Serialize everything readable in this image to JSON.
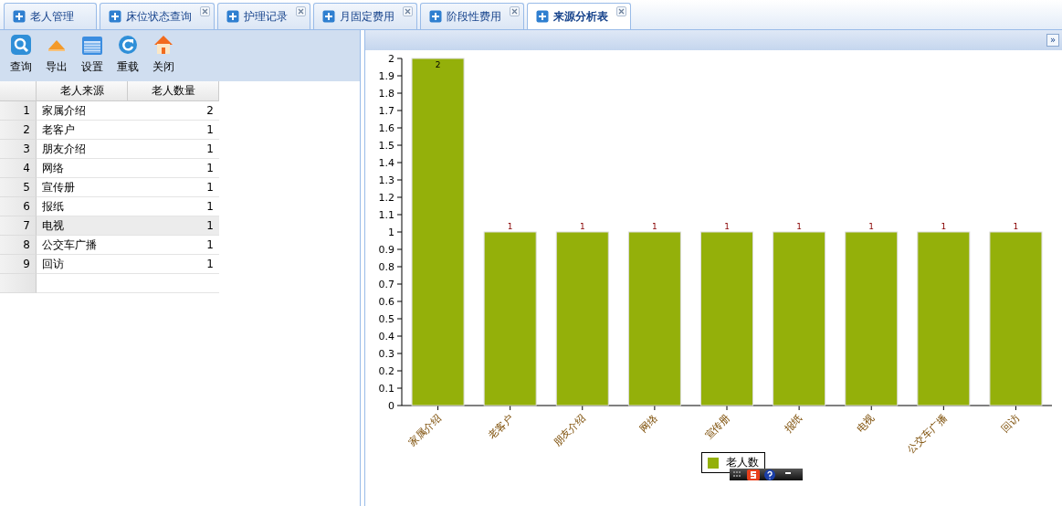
{
  "tabs": [
    {
      "label": "老人管理",
      "selected": false,
      "closable": false
    },
    {
      "label": "床位状态查询",
      "selected": false,
      "closable": true
    },
    {
      "label": "护理记录",
      "selected": false,
      "closable": true
    },
    {
      "label": "月固定费用",
      "selected": false,
      "closable": true
    },
    {
      "label": "阶段性费用",
      "selected": false,
      "closable": true
    },
    {
      "label": "来源分析表",
      "selected": true,
      "closable": true
    }
  ],
  "toolbar": [
    {
      "label": "查询",
      "kind": "search"
    },
    {
      "label": "导出",
      "kind": "export"
    },
    {
      "label": "设置",
      "kind": "settings"
    },
    {
      "label": "重载",
      "kind": "reload"
    },
    {
      "label": "关闭",
      "kind": "close"
    }
  ],
  "table": {
    "columns": [
      "老人来源",
      "老人数量"
    ],
    "rows": [
      {
        "index": "1",
        "source": "家属介绍",
        "count": "2",
        "selected": false
      },
      {
        "index": "2",
        "source": "老客户",
        "count": "1",
        "selected": false
      },
      {
        "index": "3",
        "source": "朋友介绍",
        "count": "1",
        "selected": false
      },
      {
        "index": "4",
        "source": "网络",
        "count": "1",
        "selected": false
      },
      {
        "index": "5",
        "source": "宣传册",
        "count": "1",
        "selected": false
      },
      {
        "index": "6",
        "source": "报纸",
        "count": "1",
        "selected": false
      },
      {
        "index": "7",
        "source": "电视",
        "count": "1",
        "selected": true
      },
      {
        "index": "8",
        "source": "公交车广播",
        "count": "1",
        "selected": false
      },
      {
        "index": "9",
        "source": "回访",
        "count": "1",
        "selected": false
      }
    ]
  },
  "chart": {
    "collapse_button": "»",
    "chart_data": {
      "type": "bar",
      "categories": [
        "家属介绍",
        "老客户",
        "朋友介绍",
        "网络",
        "宣传册",
        "报纸",
        "电视",
        "公交车广播",
        "回访"
      ],
      "series": [
        {
          "name": "老人数",
          "color": "#94b00a",
          "values": [
            2,
            1,
            1,
            1,
            1,
            1,
            1,
            1,
            1
          ]
        }
      ],
      "ylim": [
        0,
        2
      ],
      "yticks": [
        0,
        0.1,
        0.2,
        0.3,
        0.4,
        0.5,
        0.6,
        0.7,
        0.8,
        0.9,
        1,
        1.1,
        1.2,
        1.3,
        1.4,
        1.5,
        1.6,
        1.7,
        1.8,
        1.9,
        2
      ],
      "data_labels": true
    }
  }
}
